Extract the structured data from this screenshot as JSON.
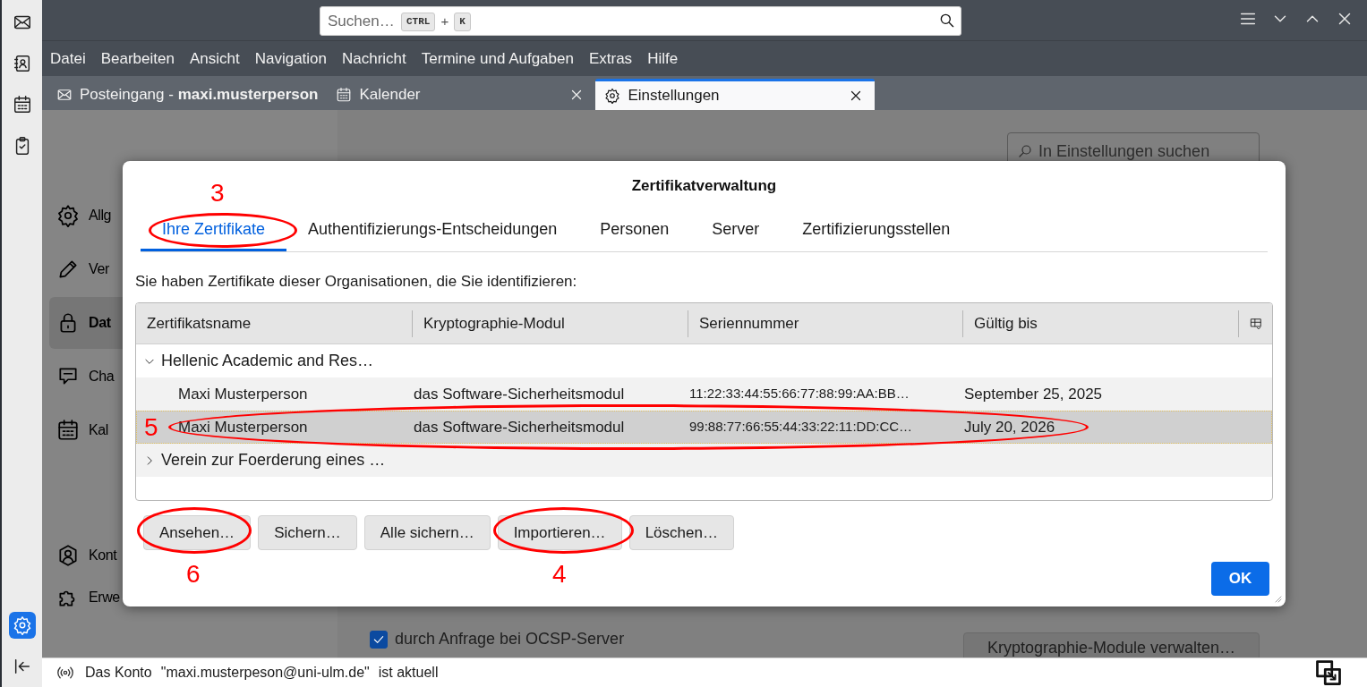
{
  "spaces_bar": {
    "items": [
      {
        "kind": "mail",
        "selected": false
      },
      {
        "kind": "address-book",
        "selected": false
      },
      {
        "kind": "calendar",
        "selected": false
      },
      {
        "kind": "tasks",
        "selected": false
      }
    ],
    "bottom_items": [
      {
        "kind": "settings",
        "selected": true
      },
      {
        "kind": "collapse",
        "selected": false
      }
    ]
  },
  "search": {
    "placeholder": "Suchen…",
    "shortcut_keys": [
      "CTRL",
      "K"
    ],
    "shortcut_joiner": "+"
  },
  "menu_bar": [
    {
      "label": "Datei"
    },
    {
      "label": "Bearbeiten"
    },
    {
      "label": "Ansicht"
    },
    {
      "label": "Navigation"
    },
    {
      "label": "Nachricht"
    },
    {
      "label": "Termine und Aufgaben"
    },
    {
      "label": "Extras"
    },
    {
      "label": "Hilfe"
    }
  ],
  "tabs": [
    {
      "kind": "mail",
      "label": "Posteingang - **maxi.musterperson**",
      "selected": false,
      "closable": false
    },
    {
      "kind": "calendar",
      "label": "Kalender",
      "selected": false,
      "closable": true
    },
    {
      "kind": "settings",
      "label": "Einstellungen",
      "selected": true,
      "closable": true
    }
  ],
  "settings_page": {
    "search_placeholder": "In Einstellungen suchen",
    "nav": [
      {
        "kind": "general",
        "label": "Allg",
        "selected": false
      },
      {
        "kind": "compose",
        "label": "Ver",
        "selected": false
      },
      {
        "kind": "privacy",
        "label": "Dat",
        "selected": true
      },
      {
        "kind": "chat",
        "label": "Cha",
        "selected": false
      },
      {
        "kind": "calendar",
        "label": "Kal",
        "selected": false
      }
    ],
    "nav_bottom": [
      {
        "kind": "account",
        "label": "Kont",
        "selected": false
      },
      {
        "kind": "addons",
        "label": "Erwe",
        "selected": false
      }
    ],
    "ocsp_checkbox": {
      "label": "durch Anfrage bei OCSP-Server",
      "checked": true
    },
    "crypto_button": "Kryptographie-Module verwalten…"
  },
  "dialog": {
    "title": "Zertifikatverwaltung",
    "tabs": [
      {
        "label": "Ihre Zertifikate",
        "selected": true
      },
      {
        "label": "Authentifizierungs-Entscheidungen",
        "selected": false
      },
      {
        "label": "Personen",
        "selected": false
      },
      {
        "label": "Server",
        "selected": false
      },
      {
        "label": "Zertifizierungsstellen",
        "selected": false
      }
    ],
    "description": "Sie haben Zertifikate dieser Organisationen, die Sie identifizieren:",
    "table": {
      "columns": [
        "Zertifikatsname",
        "Kryptographie-Modul",
        "Seriennummer",
        "Gültig bis"
      ],
      "rows": [
        {
          "name": "Hellenic Academic and Res…",
          "expanded": true,
          "selected": false,
          "children": [
            {
              "cells": [
                "Maxi Musterperson",
                "das Software-Sicherheitsmodul",
                "11:22:33:44:55:66:77:88:99:AA:BB…",
                "September 25, 2025"
              ],
              "selected": false
            },
            {
              "cells": [
                "Maxi Musterperson",
                "das Software-Sicherheitsmodul",
                "99:88:77:66:55:44:33:22:11:DD:CC…",
                "July 20, 2026"
              ],
              "selected": true
            }
          ]
        },
        {
          "name": "Verein zur Foerderung eines …",
          "expanded": false,
          "selected": false
        }
      ]
    },
    "buttons": [
      {
        "label": "Ansehen…"
      },
      {
        "label": "Sichern…"
      },
      {
        "label": "Alle sichern…"
      },
      {
        "label": "Importieren…"
      },
      {
        "label": "Löschen…"
      }
    ],
    "ok_button": "OK"
  },
  "annotations": [
    "3",
    "5",
    "6",
    "4"
  ],
  "status_bar": {
    "texts": [
      "Das Konto",
      "\"maxi.musterpeson@uni-ulm.de\"",
      "ist aktuell"
    ]
  }
}
